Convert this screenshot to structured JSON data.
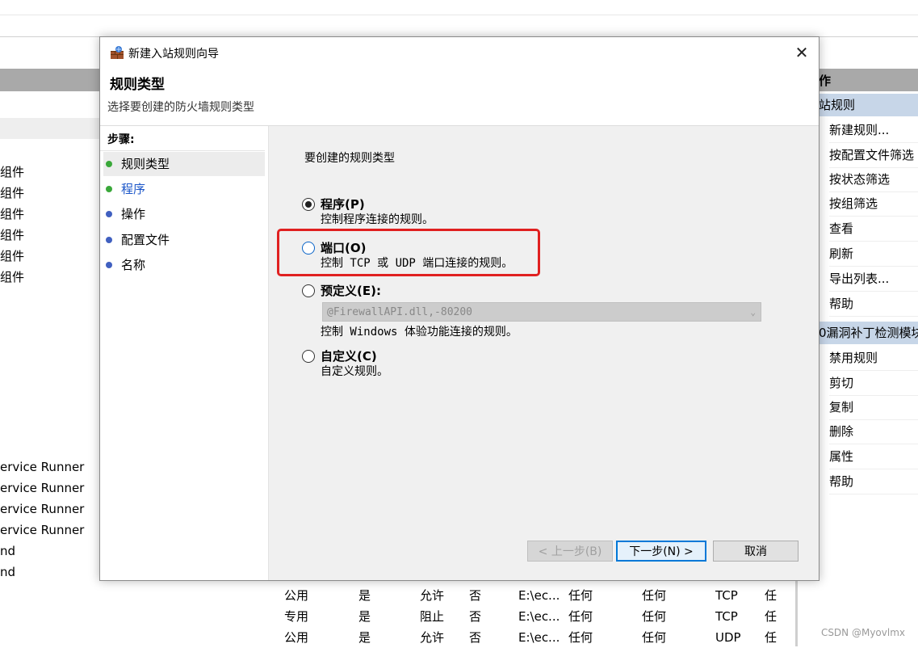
{
  "background": {
    "left_items": [
      "组件",
      "组件",
      "组件",
      "组件",
      "组件",
      "组件"
    ],
    "left_items_lower": [
      "ervice Runner",
      "ervice Runner",
      "ervice Runner",
      "ervice Runner",
      "nd",
      "nd"
    ],
    "right_panel": {
      "header": "作",
      "section1": "站规则",
      "actions1": [
        "新建规则...",
        "按配置文件筛选",
        "按状态筛选",
        "按组筛选",
        "查看",
        "刷新",
        "导出列表...",
        "帮助"
      ],
      "section2": "0漏洞补丁检测模块",
      "actions2": [
        "禁用规则",
        "剪切",
        "复制",
        "删除",
        "属性",
        "帮助"
      ]
    },
    "table_rows": [
      {
        "profile": "公用",
        "enabled": "是",
        "action": "允许",
        "override": "否",
        "program": "E:\\ec...",
        "local": "任何",
        "remote": "任何",
        "protocol": "TCP",
        "extra": "任"
      },
      {
        "profile": "专用",
        "enabled": "是",
        "action": "阻止",
        "override": "否",
        "program": "E:\\ec...",
        "local": "任何",
        "remote": "任何",
        "protocol": "TCP",
        "extra": "任"
      },
      {
        "profile": "公用",
        "enabled": "是",
        "action": "允许",
        "override": "否",
        "program": "E:\\ec...",
        "local": "任何",
        "remote": "任何",
        "protocol": "UDP",
        "extra": "任"
      }
    ]
  },
  "dialog": {
    "title": "新建入站规则向导",
    "heading": "规则类型",
    "subheading": "选择要创建的防火墙规则类型",
    "steps_title": "步骤:",
    "steps": [
      {
        "label": "规则类型",
        "color": "#3aa83a"
      },
      {
        "label": "程序",
        "color": "#3aa83a"
      },
      {
        "label": "操作",
        "color": "#4060c0"
      },
      {
        "label": "配置文件",
        "color": "#4060c0"
      },
      {
        "label": "名称",
        "color": "#4060c0"
      }
    ],
    "prompt": "要创建的规则类型",
    "options": {
      "program": {
        "label": "程序(P)",
        "desc": "控制程序连接的规则。"
      },
      "port": {
        "label": "端口(O)",
        "desc": "控制 TCP 或 UDP 端口连接的规则。"
      },
      "predefined": {
        "label": "预定义(E):",
        "select_value": "@FirewallAPI.dll,-80200",
        "desc": "控制 Windows 体验功能连接的规则。"
      },
      "custom": {
        "label": "自定义(C)",
        "desc": "自定义规则。"
      }
    },
    "buttons": {
      "back": "< 上一步(B)",
      "next": "下一步(N) >",
      "cancel": "取消"
    },
    "close_glyph": "✕"
  },
  "watermark": "CSDN @Myovlmx"
}
